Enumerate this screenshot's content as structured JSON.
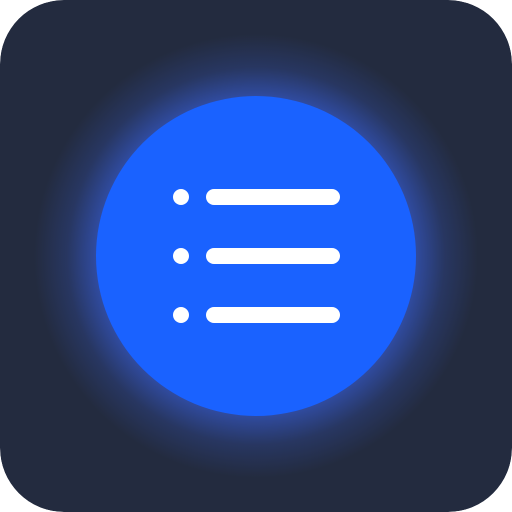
{
  "icon": {
    "name": "list-icon",
    "background_color": "#232B3F",
    "circle_color": "#1A62FF",
    "glow_color": "#3D6BFF",
    "line_color": "#FFFFFF",
    "row_count": 3
  }
}
